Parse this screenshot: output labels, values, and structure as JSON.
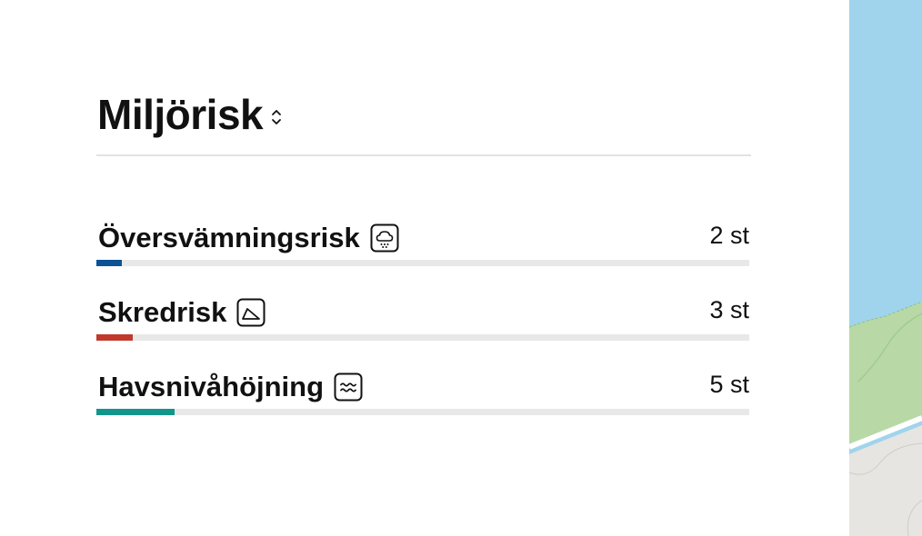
{
  "header": {
    "title": "Miljörisk",
    "sort_icon": "sort-updown-icon"
  },
  "risks": [
    {
      "label": "Översvämningsrisk",
      "icon": "cloud-rain-icon",
      "count": "2 st",
      "color": "#0b5394",
      "fill_fraction": 0.039
    },
    {
      "label": "Skredrisk",
      "icon": "landslide-slope-icon",
      "count": "3 st",
      "color": "#c0392b",
      "fill_fraction": 0.056
    },
    {
      "label": "Havsnivåhöjning",
      "icon": "waves-icon",
      "count": "5 st",
      "color": "#12968c",
      "fill_fraction": 0.12
    }
  ],
  "map": {
    "water_color": "#a0d4ec",
    "land_color": "#b8d9a6",
    "ground_color": "#e6e5e2"
  }
}
